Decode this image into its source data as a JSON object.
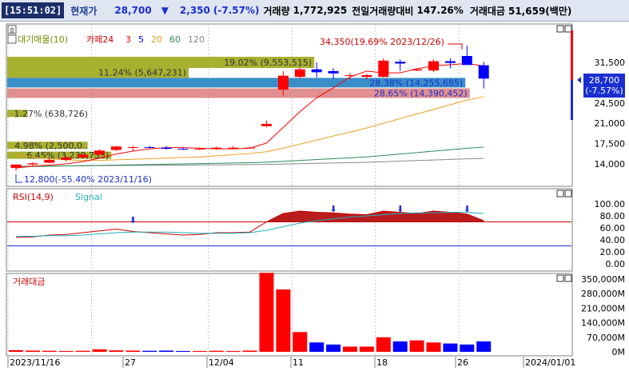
{
  "header": {
    "time": "[15:51:02]",
    "price_label": "현재가",
    "price": "28,700",
    "arrow": "▼",
    "change": "2,350",
    "change_pct": "(-7.57%)",
    "volume_label": "거래량",
    "volume": "1,772,925",
    "prev_ratio_label": "전일거래량대비",
    "prev_ratio": "147.26%",
    "amount_label": "거래대금",
    "amount": "51,659(백만)"
  },
  "colors": {
    "up": "#ff0000",
    "down": "#0000ff",
    "ma5": "#ff0000",
    "ma20": "#e8a020",
    "ma60": "#2e8b57",
    "ma120": "#888888"
  },
  "price_panel": {
    "legend": [
      "대기매물(10)",
      "카페24",
      "3",
      "5",
      "20",
      "60",
      "120"
    ],
    "max_annotation": "34,350(19.69% 2023/12/26)",
    "min_annotation": "12,800(-55.40% 2023/11/16)",
    "current_price_box": [
      "28,700",
      "(-7.57%)"
    ],
    "y_ticks": [
      "31,500",
      "28,000",
      "24,500",
      "21,000",
      "17,500",
      "14,000"
    ],
    "supply_bars": [
      {
        "label": "19.02% (9,553,515)",
        "pct": 19.02,
        "price": 31500
      },
      {
        "label": "11.24% (5,647,231)",
        "pct": 11.24,
        "price": 29800
      },
      {
        "label": "28.38% (14,255,685)",
        "pct": 28.38,
        "price": 28000
      },
      {
        "label": "28.65% (14,390,452)",
        "pct": 28.65,
        "price": 26200
      },
      {
        "label": "1.27% (638,726)",
        "pct": 1.27,
        "price": 22700
      },
      {
        "label": "4.98% (2,500,0..",
        "pct": 4.98,
        "price": 17200
      },
      {
        "label": "6.45% (3,239,733)",
        "pct": 6.45,
        "price": 15500
      }
    ]
  },
  "rsi_panel": {
    "legend": [
      "RSI(14,9)",
      "Signal"
    ],
    "y_ticks": [
      "100.00",
      "80.00",
      "60.00",
      "40.00",
      "20.00",
      "0.00"
    ]
  },
  "volume_panel": {
    "legend": "거래대금",
    "y_ticks": [
      "350,000M",
      "280,000M",
      "210,000M",
      "140,000M",
      "70,000M",
      "0M"
    ]
  },
  "x_axis": {
    "labels": [
      "2023/11/16",
      "27",
      "12/04",
      "11",
      "18",
      "26",
      "2024/01/01"
    ]
  },
  "chart_data": {
    "type": "candlestick",
    "dates": [
      "11/16",
      "11/17",
      "11/20",
      "11/21",
      "11/22",
      "11/23",
      "11/24",
      "11/27",
      "11/28",
      "11/29",
      "11/30",
      "12/01",
      "12/04",
      "12/05",
      "12/06",
      "12/07",
      "12/08",
      "12/11",
      "12/12",
      "12/13",
      "12/14",
      "12/15",
      "12/18",
      "12/19",
      "12/20",
      "12/21",
      "12/22",
      "12/26",
      "12/27"
    ],
    "ohlc": [
      [
        13300,
        13900,
        12800,
        13900
      ],
      [
        13900,
        14300,
        13700,
        14100
      ],
      [
        14200,
        15000,
        14100,
        14700
      ],
      [
        14700,
        15400,
        14400,
        15100
      ],
      [
        15100,
        15700,
        15000,
        15600
      ],
      [
        15600,
        16500,
        15500,
        16300
      ],
      [
        16400,
        17100,
        16200,
        17000
      ],
      [
        16900,
        17100,
        16300,
        16900
      ],
      [
        16900,
        17100,
        16700,
        16800
      ],
      [
        16800,
        17100,
        16500,
        16600
      ],
      [
        16600,
        16800,
        16400,
        16500
      ],
      [
        16500,
        16800,
        16400,
        16600
      ],
      [
        16600,
        17000,
        16400,
        16800
      ],
      [
        16800,
        17100,
        16700,
        16800
      ],
      [
        16800,
        17000,
        16700,
        16800
      ],
      [
        20500,
        21500,
        20300,
        20900
      ],
      [
        26800,
        30000,
        25800,
        29200
      ],
      [
        29000,
        30700,
        28800,
        30300
      ],
      [
        30300,
        31500,
        28900,
        29800
      ],
      [
        30000,
        30500,
        28600,
        29600
      ],
      [
        29300,
        29700,
        28500,
        29300
      ],
      [
        29000,
        29500,
        28500,
        29300
      ],
      [
        29000,
        32200,
        28900,
        31800
      ],
      [
        31600,
        32000,
        30000,
        31300
      ],
      [
        30100,
        30300,
        30000,
        30300
      ],
      [
        30100,
        32000,
        29800,
        31700
      ],
      [
        31700,
        32200,
        30500,
        31400
      ],
      [
        32600,
        34350,
        31200,
        31050
      ],
      [
        31000,
        31600,
        27000,
        28700
      ]
    ],
    "ma5": [
      13300,
      13600,
      13800,
      14000,
      14400,
      15000,
      15700,
      16200,
      16600,
      16800,
      16800,
      16700,
      16600,
      16600,
      16700,
      17600,
      20300,
      23000,
      25400,
      27100,
      29000,
      30000,
      29700,
      29700,
      30400,
      30900,
      31100,
      31300,
      30900
    ],
    "ma20": [
      15500,
      15200,
      14900,
      14700,
      14600,
      14600,
      14700,
      14800,
      14900,
      15000,
      15100,
      15200,
      15400,
      15600,
      15800,
      16100,
      16700,
      17400,
      18100,
      18800,
      19500,
      20200,
      21000,
      21800,
      22600,
      23400,
      24200,
      25000,
      25600
    ],
    "ma60": [
      13500,
      13550,
      13600,
      13650,
      13700,
      13750,
      13800,
      13850,
      13900,
      13950,
      14000,
      14050,
      14100,
      14150,
      14200,
      14300,
      14450,
      14600,
      14750,
      14900,
      15050,
      15200,
      15450,
      15700,
      15950,
      16200,
      16450,
      16700,
      16900
    ],
    "ma120": [
      13600,
      13620,
      13640,
      13660,
      13680,
      13700,
      13720,
      13740,
      13760,
      13780,
      13800,
      13820,
      13840,
      13860,
      13880,
      13920,
      13980,
      14040,
      14100,
      14160,
      14220,
      14280,
      14380,
      14480,
      14580,
      14680,
      14780,
      14880,
      14950
    ],
    "rsi": [
      44,
      45,
      48,
      49,
      52,
      55,
      58,
      54,
      52,
      50,
      48,
      49,
      52,
      52,
      53,
      70,
      84,
      88,
      86,
      85,
      83,
      82,
      88,
      86,
      84,
      88,
      86,
      83,
      72
    ],
    "rsi_signal": [
      46,
      46,
      47,
      47,
      48,
      50,
      52,
      53,
      53,
      53,
      52,
      51,
      51,
      51,
      52,
      56,
      62,
      68,
      72,
      75,
      78,
      80,
      82,
      84,
      85,
      85,
      86,
      86,
      84
    ],
    "volume_m": [
      8000,
      6000,
      5000,
      4000,
      5000,
      12000,
      7000,
      6000,
      5000,
      6000,
      4000,
      4000,
      5000,
      4000,
      6000,
      380000,
      300000,
      95000,
      45000,
      35000,
      25000,
      25000,
      70000,
      50000,
      55000,
      45000,
      40000,
      35000,
      50000
    ]
  }
}
